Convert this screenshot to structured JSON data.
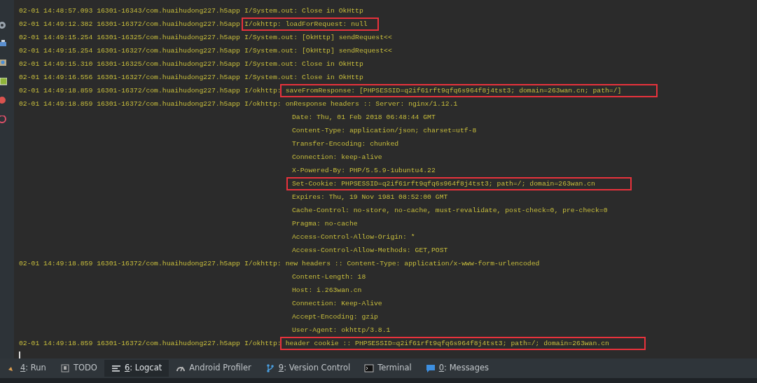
{
  "log_lines": [
    {
      "prefix": "02-01 14:48:57.093 16301-16343/com.huaihudong227.h5app",
      "tag": "I/System.out:",
      "message": "Close in OkHttp",
      "highlighted": false
    },
    {
      "prefix": "02-01 14:49:12.382 16301-16372/com.huaihudong227.h5app",
      "tag": "I/okhttp:",
      "message": "loadForRequest: null",
      "highlighted": true,
      "tag_in_box": true
    },
    {
      "prefix": "02-01 14:49:15.254 16301-16325/com.huaihudong227.h5app",
      "tag": "I/System.out:",
      "message": "[OkHttp] sendRequest<<",
      "highlighted": false
    },
    {
      "prefix": "02-01 14:49:15.254 16301-16327/com.huaihudong227.h5app",
      "tag": "I/System.out:",
      "message": "[OkHttp] sendRequest<<",
      "highlighted": false
    },
    {
      "prefix": "02-01 14:49:15.310 16301-16325/com.huaihudong227.h5app",
      "tag": "I/System.out:",
      "message": "Close in OkHttp",
      "highlighted": false
    },
    {
      "prefix": "02-01 14:49:16.556 16301-16327/com.huaihudong227.h5app",
      "tag": "I/System.out:",
      "message": "Close in OkHttp",
      "highlighted": false
    },
    {
      "prefix": "02-01 14:49:18.859 16301-16372/com.huaihudong227.h5app",
      "tag": "I/okhttp:",
      "message": "saveFromResponse: [PHPSESSID=q2if61rft9qfq6s964f8j4tst3; domain=263wan.cn; path=/]",
      "highlighted": true,
      "tag_in_box": false
    },
    {
      "prefix": "02-01 14:49:18.859 16301-16372/com.huaihudong227.h5app",
      "tag": "I/okhttp:",
      "message": "onResponse headers :: Server: nginx/1.12.1",
      "highlighted": false
    },
    {
      "message": "Date: Thu, 01 Feb 2018 06:48:44 GMT",
      "highlighted": false
    },
    {
      "message": "Content-Type: application/json; charset=utf-8",
      "highlighted": false
    },
    {
      "message": "Transfer-Encoding: chunked",
      "highlighted": false
    },
    {
      "message": "Connection: keep-alive",
      "highlighted": false
    },
    {
      "message": "X-Powered-By: PHP/5.5.9-1ubuntu4.22",
      "highlighted": false
    },
    {
      "message": "Set-Cookie: PHPSESSID=q2if61rft9qfq6s964f8j4tst3; path=/; domain=263wan.cn",
      "highlighted": true
    },
    {
      "message": "Expires: Thu, 19 Nov 1981 08:52:00 GMT",
      "highlighted": false
    },
    {
      "message": "Cache-Control: no-store, no-cache, must-revalidate, post-check=0, pre-check=0",
      "highlighted": false
    },
    {
      "message": "Pragma: no-cache",
      "highlighted": false
    },
    {
      "message": "Access-Control-Allow-Origin: *",
      "highlighted": false
    },
    {
      "message": "Access-Control-Allow-Methods: GET,POST",
      "highlighted": false
    },
    {
      "prefix": "02-01 14:49:18.859 16301-16372/com.huaihudong227.h5app",
      "tag": "I/okhttp:",
      "message": "new headers :: Content-Type: application/x-www-form-urlencoded",
      "highlighted": false
    },
    {
      "message": "Content-Length: 18",
      "highlighted": false
    },
    {
      "message": "Host: i.263wan.cn",
      "highlighted": false
    },
    {
      "message": "Connection: Keep-Alive",
      "highlighted": false
    },
    {
      "message": "Accept-Encoding: gzip",
      "highlighted": false
    },
    {
      "message": "User-Agent: okhttp/3.8.1",
      "highlighted": false
    },
    {
      "prefix": "02-01 14:49:18.859 16301-16372/com.huaihudong227.h5app",
      "tag": "I/okhttp:",
      "message": "header cookie :: PHPSESSID=q2if61rft9qfq6s964f8j4tst3; path=/; domain=263wan.cn",
      "highlighted": true,
      "tag_in_box": false
    }
  ],
  "tool_tabs": [
    {
      "kind": "run",
      "key": "4",
      "label": ": Run",
      "selected": false
    },
    {
      "kind": "todo",
      "label": "TODO",
      "selected": false
    },
    {
      "kind": "logcat",
      "key": "6",
      "label": ": Logcat",
      "selected": true
    },
    {
      "kind": "profiler",
      "label": "Android Profiler",
      "selected": false
    },
    {
      "kind": "vcs",
      "key": "9",
      "label": ": Version Control",
      "selected": false
    },
    {
      "kind": "terminal",
      "label": "Terminal",
      "selected": false
    },
    {
      "kind": "messages",
      "key": "0",
      "label": ": Messages",
      "selected": false
    }
  ]
}
